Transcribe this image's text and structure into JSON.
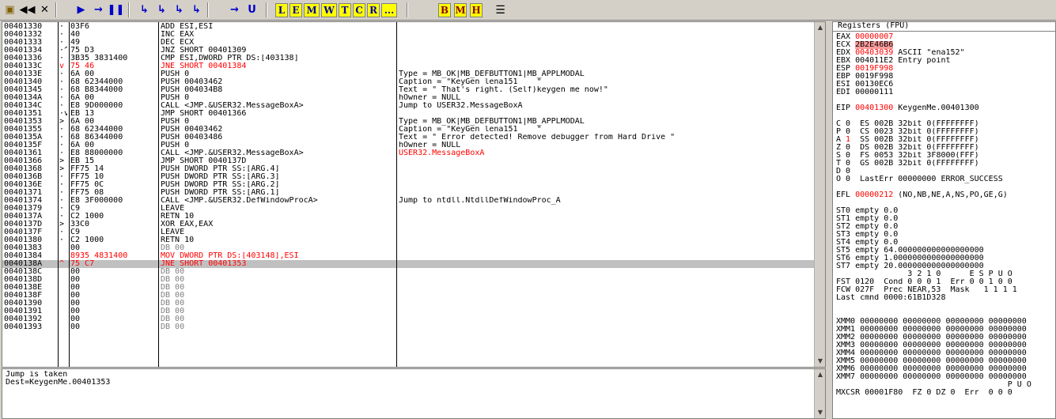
{
  "toolbar": {
    "buttons": [
      "▶",
      "◀◀",
      "✕",
      "▶",
      "→",
      "❚❚",
      "↳",
      "↳",
      "↳",
      "↳",
      "→",
      "U"
    ],
    "letters": [
      "L",
      "E",
      "M",
      "W",
      "T",
      "C",
      "R",
      "..."
    ],
    "letters2": [
      "B",
      "M",
      "H"
    ],
    "last_icon": "☰"
  },
  "rows": [
    {
      "addr": "00401330",
      "mk": "·",
      "hex": "03F6",
      "dis": "ADD ESI,ESI",
      "com": ""
    },
    {
      "addr": "00401332",
      "mk": "·",
      "hex": "40",
      "dis": "INC EAX",
      "com": ""
    },
    {
      "addr": "00401333",
      "mk": "·",
      "hex": "49",
      "dis": "DEC ECX",
      "com": ""
    },
    {
      "addr": "00401334",
      "mk": "·^",
      "hex": "75 D3",
      "dis": "JNZ SHORT 00401309",
      "com": ""
    },
    {
      "addr": "00401336",
      "mk": "·",
      "hex": "3B35 3831400",
      "dis": "CMP ESI,DWORD PTR DS:[403138]",
      "com": ""
    },
    {
      "addr": "0040133C",
      "mk": "v",
      "hex": "75 46",
      "dis": "JNE SHORT 00401384",
      "com": "",
      "red": true
    },
    {
      "addr": "0040133E",
      "mk": "·",
      "hex": "6A 00",
      "dis": "PUSH 0",
      "com": "Type = MB_OK|MB_DEFBUTTON1|MB_APPLMODAL"
    },
    {
      "addr": "00401340",
      "mk": "·",
      "hex": "68 62344000",
      "dis": "PUSH 00403462",
      "com": "Caption = \"KeyGen lena151    \""
    },
    {
      "addr": "00401345",
      "mk": "·",
      "hex": "68 B8344000",
      "dis": "PUSH 004034B8",
      "com": "Text = \" That's right. (Self)keygen me now!\""
    },
    {
      "addr": "0040134A",
      "mk": "·",
      "hex": "6A 00",
      "dis": "PUSH 0",
      "com": "hOwner = NULL"
    },
    {
      "addr": "0040134C",
      "mk": "·",
      "hex": "E8 9D000000",
      "dis": "CALL <JMP.&USER32.MessageBoxA>",
      "com": "Jump to USER32.MessageBoxA"
    },
    {
      "addr": "00401351",
      "mk": "·v",
      "hex": "EB 13",
      "dis": "JMP SHORT 00401366",
      "com": ""
    },
    {
      "addr": "00401353",
      "mk": ">",
      "hex": "6A 00",
      "dis": "PUSH 0",
      "com": "Type = MB_OK|MB_DEFBUTTON1|MB_APPLMODAL"
    },
    {
      "addr": "00401355",
      "mk": "·",
      "hex": "68 62344000",
      "dis": "PUSH 00403462",
      "com": "Caption = \"KeyGen lena151    \""
    },
    {
      "addr": "0040135A",
      "mk": "·",
      "hex": "68 86344000",
      "dis": "PUSH 00403486",
      "com": "Text = \" Error detected! Remove debugger from Hard Drive \""
    },
    {
      "addr": "0040135F",
      "mk": "·",
      "hex": "6A 00",
      "dis": "PUSH 0",
      "com": "hOwner = NULL"
    },
    {
      "addr": "00401361",
      "mk": "·",
      "hex": "E8 88000000",
      "dis": "CALL <JMP.&USER32.MessageBoxA>",
      "com": "USER32.MessageBoxA",
      "comred": true
    },
    {
      "addr": "00401366",
      "mk": ">",
      "hex": "EB 15",
      "dis": "JMP SHORT 0040137D",
      "com": ""
    },
    {
      "addr": "00401368",
      "mk": ">",
      "hex": "FF75 14",
      "dis": "PUSH DWORD PTR SS:[ARG.4]",
      "com": ""
    },
    {
      "addr": "0040136B",
      "mk": "·",
      "hex": "FF75 10",
      "dis": "PUSH DWORD PTR SS:[ARG.3]",
      "com": ""
    },
    {
      "addr": "0040136E",
      "mk": "·",
      "hex": "FF75 0C",
      "dis": "PUSH DWORD PTR SS:[ARG.2]",
      "com": ""
    },
    {
      "addr": "00401371",
      "mk": "·",
      "hex": "FF75 08",
      "dis": "PUSH DWORD PTR SS:[ARG.1]",
      "com": ""
    },
    {
      "addr": "00401374",
      "mk": "·",
      "hex": "E8 3F000000",
      "dis": "CALL <JMP.&USER32.DefWindowProcA>",
      "com": "Jump to ntdll.NtdllDefWindowProc_A"
    },
    {
      "addr": "00401379",
      "mk": "·",
      "hex": "C9",
      "dis": "LEAVE",
      "com": ""
    },
    {
      "addr": "0040137A",
      "mk": "·",
      "hex": "C2 1000",
      "dis": "RETN 10",
      "com": ""
    },
    {
      "addr": "0040137D",
      "mk": ">",
      "hex": "33C0",
      "dis": "XOR EAX,EAX",
      "com": ""
    },
    {
      "addr": "0040137F",
      "mk": "·",
      "hex": "C9",
      "dis": "LEAVE",
      "com": ""
    },
    {
      "addr": "00401380",
      "mk": "·",
      "hex": "C2 1000",
      "dis": "RETN 10",
      "com": ""
    },
    {
      "addr": "00401383",
      "mk": "",
      "hex": "00",
      "dis": "DB 00",
      "com": "",
      "gray": true
    },
    {
      "addr": "00401384",
      "mk": "",
      "hex": "8935 4831400",
      "dis": "MOV DWORD PTR DS:[403148],ESI",
      "com": "",
      "red": true
    },
    {
      "addr": "0040138A",
      "mk": "^",
      "hex": "75 C7",
      "dis": "JNE SHORT 00401353",
      "com": "",
      "red": true,
      "sel": true
    },
    {
      "addr": "0040138C",
      "mk": "",
      "hex": "00",
      "dis": "DB 00",
      "com": "",
      "gray": true
    },
    {
      "addr": "0040138D",
      "mk": "",
      "hex": "00",
      "dis": "DB 00",
      "com": "",
      "gray": true
    },
    {
      "addr": "0040138E",
      "mk": "",
      "hex": "00",
      "dis": "DB 00",
      "com": "",
      "gray": true
    },
    {
      "addr": "0040138F",
      "mk": "",
      "hex": "00",
      "dis": "DB 00",
      "com": "",
      "gray": true
    },
    {
      "addr": "00401390",
      "mk": "",
      "hex": "00",
      "dis": "DB 00",
      "com": "",
      "gray": true
    },
    {
      "addr": "00401391",
      "mk": "",
      "hex": "00",
      "dis": "DB 00",
      "com": "",
      "gray": true
    },
    {
      "addr": "00401392",
      "mk": "",
      "hex": "00",
      "dis": "DB 00",
      "com": "",
      "gray": true
    },
    {
      "addr": "00401393",
      "mk": "",
      "hex": "00",
      "dis": "DB 00",
      "com": "",
      "gray": true
    }
  ],
  "info": {
    "line1": "Jump is taken",
    "line2": "Dest=KeygenMe.00401353"
  },
  "registers": {
    "title": "Registers (FPU)",
    "lines": [
      {
        "t": "EAX ",
        "v": "00000007",
        "vc": "red",
        "r": ""
      },
      {
        "t": "ECX ",
        "v": "2B2E46B6",
        "vc": "hl",
        "r": ""
      },
      {
        "t": "EDX ",
        "v": "00403039",
        "vc": "red",
        "r": " ASCII \"ena152\""
      },
      {
        "t": "EBX ",
        "v": "004011E2",
        "vc": "",
        "r": " Entry point"
      },
      {
        "t": "ESP ",
        "v": "0019F998",
        "vc": "red",
        "r": ""
      },
      {
        "t": "EBP ",
        "v": "0019F998",
        "vc": "",
        "r": ""
      },
      {
        "t": "ESI ",
        "v": "00130EC6",
        "vc": "",
        "r": ""
      },
      {
        "t": "EDI ",
        "v": "00000111",
        "vc": "",
        "r": ""
      },
      {
        "t": "",
        "v": "",
        "vc": "",
        "r": ""
      },
      {
        "t": "EIP ",
        "v": "00401300",
        "vc": "red",
        "r": " KeygenMe.00401300"
      },
      {
        "t": "",
        "v": "",
        "vc": "",
        "r": ""
      },
      {
        "t": "C 0  ",
        "v": "",
        "vc": "",
        "r": "ES 002B 32bit 0(FFFFFFFF)"
      },
      {
        "t": "P 0  ",
        "v": "",
        "vc": "",
        "r": "CS 0023 32bit 0(FFFFFFFF)"
      },
      {
        "t": "A ",
        "v": "1",
        "vc": "red",
        "r": "  SS 002B 32bit 0(FFFFFFFF)"
      },
      {
        "t": "Z 0  ",
        "v": "",
        "vc": "",
        "r": "DS 002B 32bit 0(FFFFFFFF)"
      },
      {
        "t": "S 0  ",
        "v": "",
        "vc": "",
        "r": "FS 0053 32bit 3F8000(FFF)"
      },
      {
        "t": "T 0  ",
        "v": "",
        "vc": "",
        "r": "GS 002B 32bit 0(FFFFFFFF)"
      },
      {
        "t": "D 0",
        "v": "",
        "vc": "",
        "r": ""
      },
      {
        "t": "O 0  ",
        "v": "",
        "vc": "",
        "r": "LastErr 00000000 ERROR_SUCCESS"
      },
      {
        "t": "",
        "v": "",
        "vc": "",
        "r": ""
      },
      {
        "t": "EFL ",
        "v": "00000212",
        "vc": "red",
        "r": " (NO,NB,NE,A,NS,PO,GE,G)"
      },
      {
        "t": "",
        "v": "",
        "vc": "",
        "r": ""
      },
      {
        "t": "ST0 empty 0.0",
        "v": "",
        "vc": "",
        "r": ""
      },
      {
        "t": "ST1 empty 0.0",
        "v": "",
        "vc": "",
        "r": ""
      },
      {
        "t": "ST2 empty 0.0",
        "v": "",
        "vc": "",
        "r": ""
      },
      {
        "t": "ST3 empty 0.0",
        "v": "",
        "vc": "",
        "r": ""
      },
      {
        "t": "ST4 empty 0.0",
        "v": "",
        "vc": "",
        "r": ""
      },
      {
        "t": "ST5 empty 64.000000000000000000",
        "v": "",
        "vc": "",
        "r": ""
      },
      {
        "t": "ST6 empty 1.0000000000000000000",
        "v": "",
        "vc": "",
        "r": ""
      },
      {
        "t": "ST7 empty 20.000000000000000000",
        "v": "",
        "vc": "",
        "r": ""
      },
      {
        "t": "               3 2 1 0      E S P U O",
        "v": "",
        "vc": "",
        "r": ""
      },
      {
        "t": "FST 0120  Cond 0 0 0 1  Err 0 0 1 0 0",
        "v": "",
        "vc": "",
        "r": ""
      },
      {
        "t": "FCW 027F  Prec NEAR,53  Mask   1 1 1 1",
        "v": "",
        "vc": "",
        "r": ""
      },
      {
        "t": "Last cmnd 0000:61B1D328",
        "v": "",
        "vc": "",
        "r": ""
      },
      {
        "t": "",
        "v": "",
        "vc": "",
        "r": ""
      },
      {
        "t": "",
        "v": "",
        "vc": "",
        "r": ""
      },
      {
        "t": "XMM0 00000000 00000000 00000000 00000000",
        "v": "",
        "vc": "",
        "r": ""
      },
      {
        "t": "XMM1 00000000 00000000 00000000 00000000",
        "v": "",
        "vc": "",
        "r": ""
      },
      {
        "t": "XMM2 00000000 00000000 00000000 00000000",
        "v": "",
        "vc": "",
        "r": ""
      },
      {
        "t": "XMM3 00000000 00000000 00000000 00000000",
        "v": "",
        "vc": "",
        "r": ""
      },
      {
        "t": "XMM4 00000000 00000000 00000000 00000000",
        "v": "",
        "vc": "",
        "r": ""
      },
      {
        "t": "XMM5 00000000 00000000 00000000 00000000",
        "v": "",
        "vc": "",
        "r": ""
      },
      {
        "t": "XMM6 00000000 00000000 00000000 00000000",
        "v": "",
        "vc": "",
        "r": ""
      },
      {
        "t": "XMM7 00000000 00000000 00000000 00000000",
        "v": "",
        "vc": "",
        "r": ""
      },
      {
        "t": "                                    P U O",
        "v": "",
        "vc": "",
        "r": ""
      },
      {
        "t": "MXCSR 00001F80  FZ 0 DZ 0  Err  0 0 0",
        "v": "",
        "vc": "",
        "r": ""
      }
    ]
  },
  "scroll": {
    "up": "▲",
    "down": "▼"
  }
}
